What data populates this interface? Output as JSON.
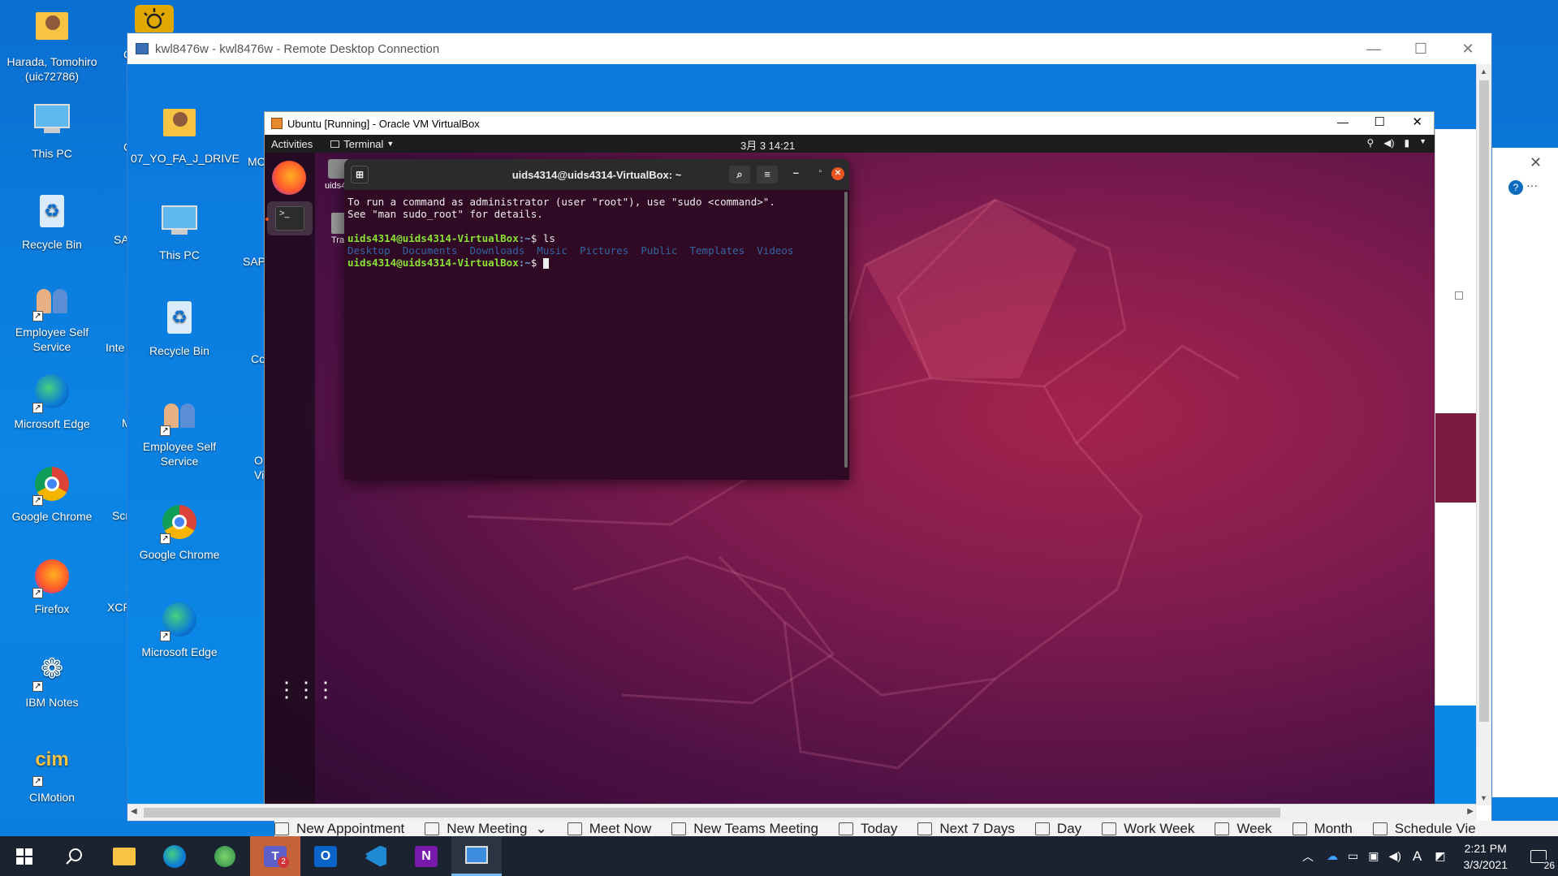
{
  "desktop_left_icons": [
    {
      "label": "Harada, Tomohiro (uic72786)",
      "icon": "user-folder-icon"
    },
    {
      "label": "This PC",
      "icon": "computer-icon"
    },
    {
      "label": "Recycle Bin",
      "icon": "recycle-bin-icon"
    },
    {
      "label": "Employee Self Service",
      "icon": "people-icon"
    },
    {
      "label": "Microsoft Edge",
      "icon": "edge-icon"
    },
    {
      "label": "Google Chrome",
      "icon": "chrome-icon"
    },
    {
      "label": "Firefox",
      "icon": "firefox-icon"
    },
    {
      "label": "IBM Notes",
      "icon": "ibm-notes-icon"
    },
    {
      "label": "CIMotion",
      "icon": "cimotion-icon"
    }
  ],
  "desktop_cut_labels": [
    "Cli",
    "SA",
    "Inte",
    "M",
    "Scr",
    "XCP"
  ],
  "remote_cut_labels": [
    "MC",
    "SAP",
    "Co",
    "O",
    "Vi"
  ],
  "remote_icons": [
    {
      "label": "07_YO_FA_J_DRIVE",
      "icon": "user-folder-icon"
    },
    {
      "label": "This PC",
      "icon": "computer-icon"
    },
    {
      "label": "Recycle Bin",
      "icon": "recycle-bin-icon"
    },
    {
      "label": "Employee Self Service",
      "icon": "people-icon"
    },
    {
      "label": "Google Chrome",
      "icon": "chrome-icon"
    },
    {
      "label": "Microsoft Edge",
      "icon": "edge-icon"
    }
  ],
  "rdp": {
    "title": "kwl8476w - kwl8476w - Remote Desktop Connection",
    "minimize": "—",
    "maximize": "☐",
    "close": "✕"
  },
  "vbox": {
    "title": "Ubuntu [Running] - Oracle VM VirtualBox",
    "minimize": "—",
    "maximize": "☐",
    "close": "✕"
  },
  "ubuntu": {
    "activities": "Activities",
    "app_menu": "Terminal",
    "clock": "3月 3  14:21",
    "home_label": "uids4",
    "trash_label": "Tra"
  },
  "terminal": {
    "title": "uids4314@uids4314-VirtualBox: ~",
    "line1": "To run a command as administrator (user \"root\"), use \"sudo <command>\".",
    "line2": "See \"man sudo_root\" for details.",
    "prompt": "uids4314@uids4314-VirtualBox",
    "path": ":~",
    "command": "$ ls",
    "dollar": "$ ",
    "dirs": [
      "Desktop",
      "Documents",
      "Downloads",
      "Music",
      "Pictures",
      "Public",
      "Templates",
      "Videos"
    ]
  },
  "ribbon": [
    {
      "label": "New Appointment",
      "icon": "calendar-icon"
    },
    {
      "label": "New Meeting",
      "icon": "meeting-icon"
    },
    {
      "label": "Meet Now",
      "icon": "video-icon"
    },
    {
      "label": "New Teams Meeting",
      "icon": "teams-icon"
    },
    {
      "label": "Today",
      "icon": "today-icon"
    },
    {
      "label": "Next 7 Days",
      "icon": "week-icon"
    },
    {
      "label": "Day",
      "icon": "day-icon"
    },
    {
      "label": "Work Week",
      "icon": "workweek-icon"
    },
    {
      "label": "Week",
      "icon": "week-view-icon"
    },
    {
      "label": "Month",
      "icon": "month-icon"
    },
    {
      "label": "Schedule Vie",
      "icon": "schedule-icon"
    }
  ],
  "taskbar": {
    "apps": [
      "start-icon",
      "search-icon",
      "file-explorer-icon",
      "edge-icon",
      "network-globe-icon",
      "teams-icon",
      "outlook-icon",
      "vscode-icon",
      "onenote-icon",
      "remote-desktop-icon"
    ],
    "teams_badge": "2",
    "time": "2:21 PM",
    "date": "3/3/2021",
    "ime": "A",
    "notification_count": "26"
  },
  "colors": {
    "accent": "#0078d7",
    "ubuntu_bg": "#7d1b4e",
    "terminal_bg": "#300a24",
    "prompt_green": "#8ae234",
    "dir_blue": "#729fcf"
  }
}
